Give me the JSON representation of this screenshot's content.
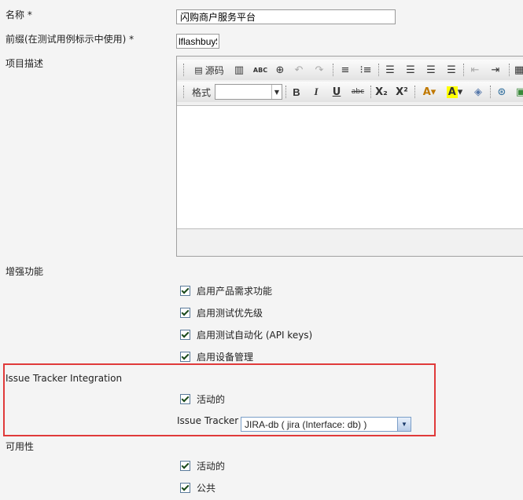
{
  "form": {
    "name_label": "名称 *",
    "name_value": "闪购商户服务平台",
    "prefix_label": "前缀(在测试用例标示中使用) *",
    "prefix_value": "lflashbuy$",
    "description_label": "项目描述"
  },
  "editor": {
    "source_label": "源码",
    "format_label": "格式",
    "bold": "B",
    "italic": "I",
    "underline": "U",
    "strike": "abc",
    "subscript": "X₂",
    "superscript": "X²",
    "spellcheck": "ABC"
  },
  "enhanced": {
    "label": "增强功能",
    "options": [
      "启用产品需求功能",
      "启用测试优先级",
      "启用测试自动化 (API keys)",
      "启用设备管理"
    ]
  },
  "issue_tracker": {
    "section_label": "Issue Tracker Integration",
    "active_label": "活动的",
    "tracker_label": "Issue Tracker",
    "tracker_value": "JIRA-db ( jira (Interface: db) )"
  },
  "availability": {
    "label": "可用性",
    "options": [
      "活动的",
      "公共"
    ]
  },
  "colors": {
    "highlight_border": "#e03a3a",
    "background": "#f4f4f4"
  }
}
